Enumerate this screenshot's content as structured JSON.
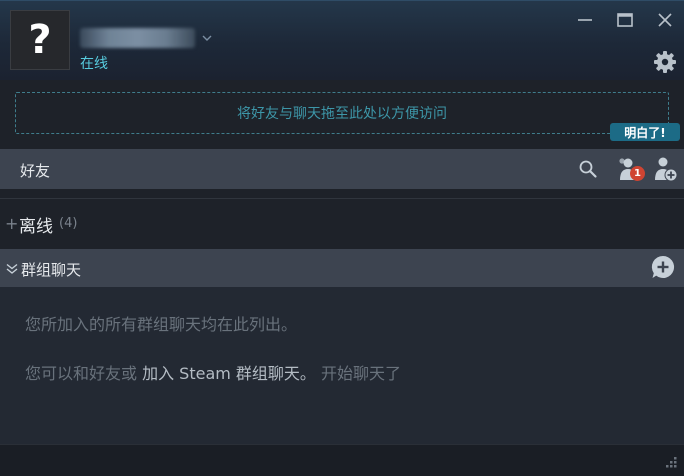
{
  "header": {
    "avatar_glyph": "?",
    "status": "在线"
  },
  "dropzone": {
    "text": "将好友与聊天拖至此处以方便访问"
  },
  "tooltip": {
    "got_it": "明白了!"
  },
  "friends": {
    "title": "好友",
    "pending_badge": "1"
  },
  "offline": {
    "plus": "+",
    "label": "离线",
    "count": "(4)"
  },
  "group_chats": {
    "title": "群组聊天",
    "empty_line1": "您所加入的所有群组聊天均在此列出。",
    "empty_line2_prefix": "您可以和好友或 ",
    "empty_line2_link": "加入 Steam 群组聊天。",
    "empty_line2_suffix": " 开始聊天了"
  },
  "icons": {
    "minimize": "minimize-icon",
    "maximize": "maximize-icon",
    "close": "close-icon",
    "settings": "gear-icon",
    "search": "search-icon",
    "friend_requests": "friend-requests-icon",
    "add_friend": "add-friend-icon",
    "add_group": "add-group-chat-icon",
    "resize": "resize-grip-icon"
  },
  "colors": {
    "status_online": "#57cbde",
    "accent_blue": "#1c6b86",
    "badge_red": "#d04432",
    "bar_bg": "#3d4450"
  }
}
